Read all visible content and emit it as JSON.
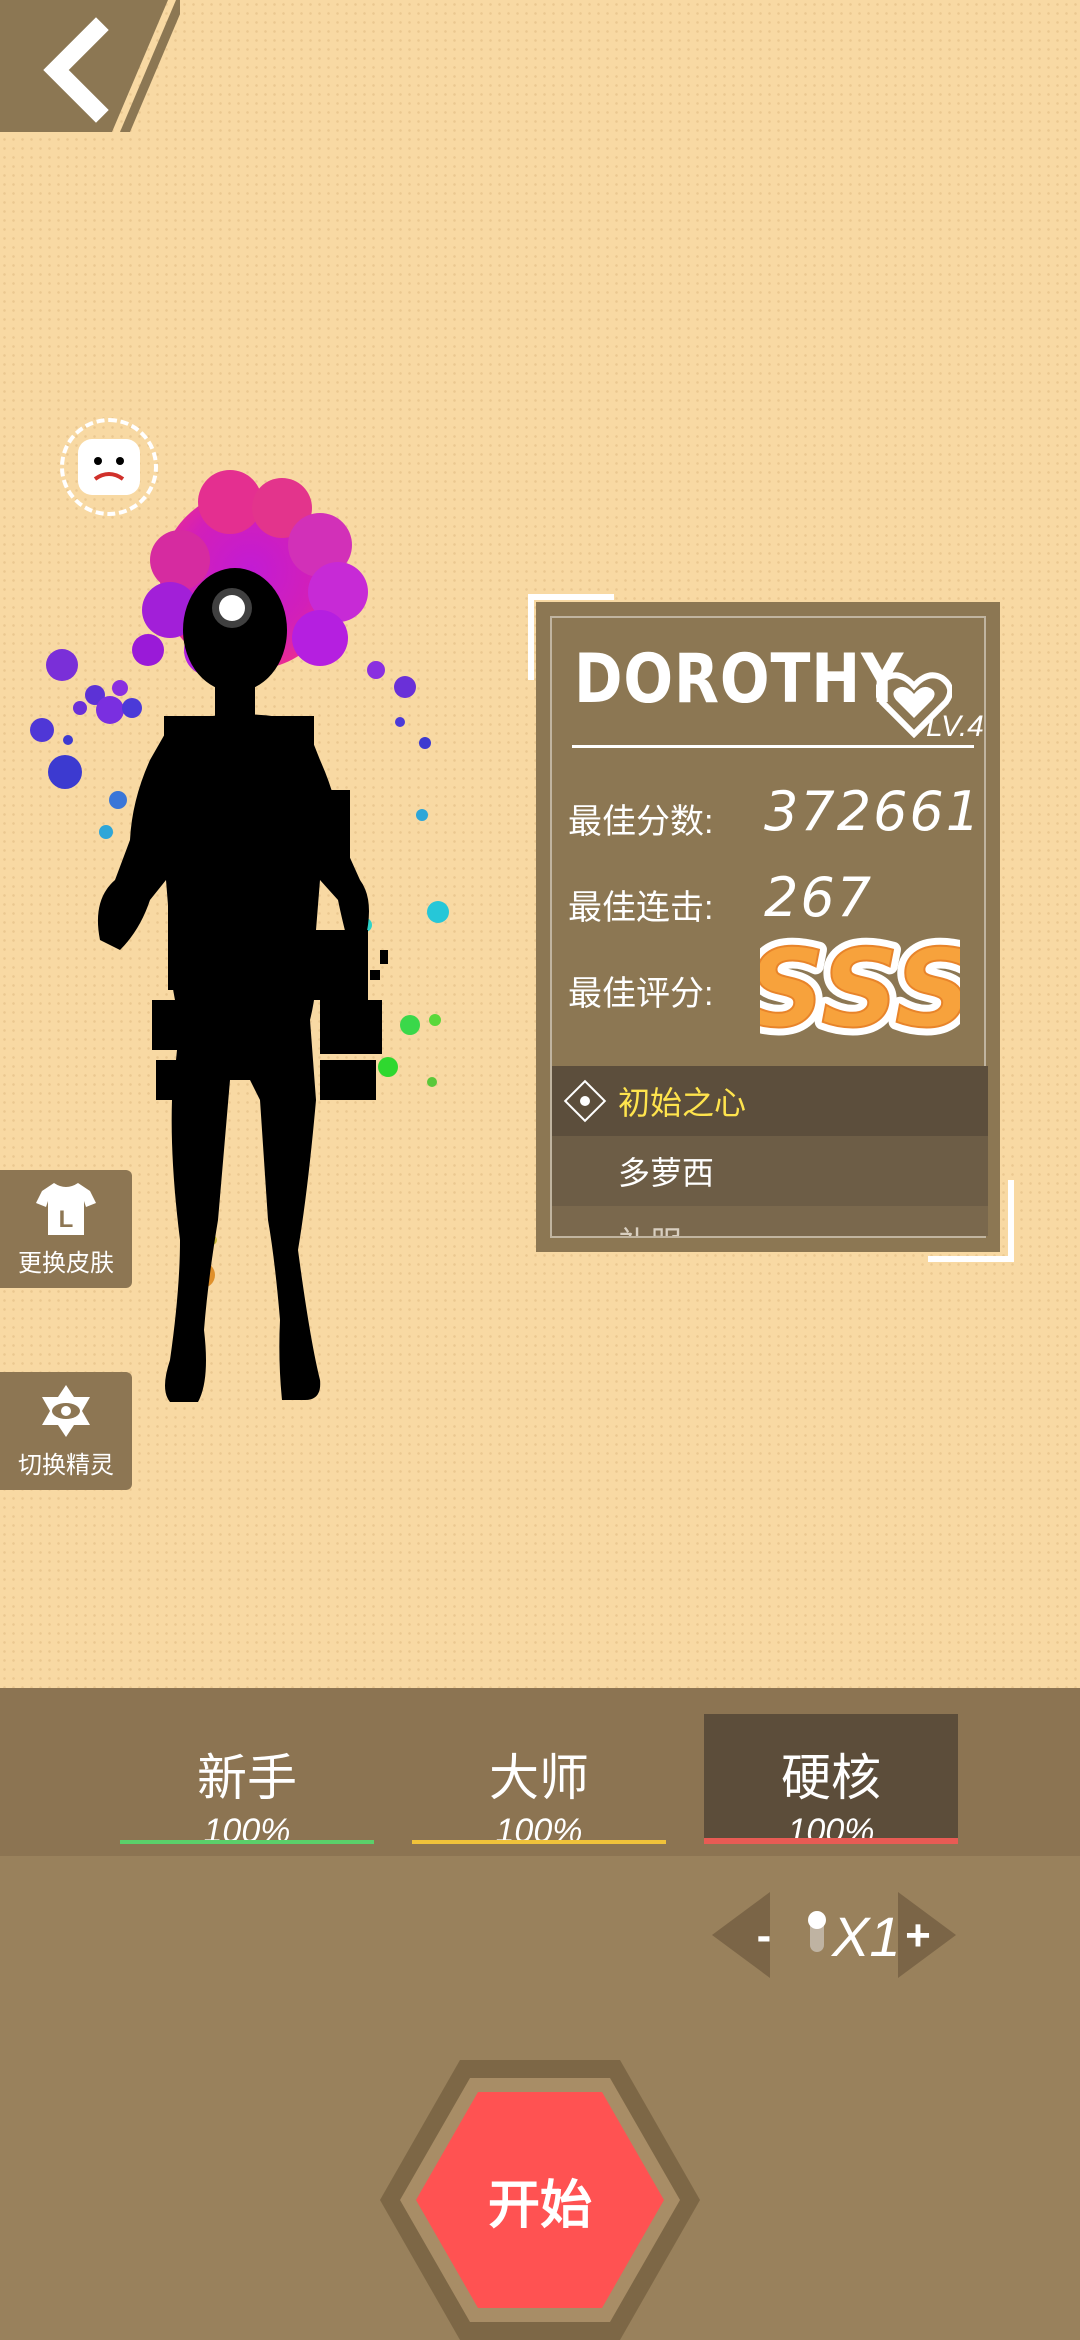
{
  "header": {
    "back_icon": "chevron-left-icon"
  },
  "emoji_badge": {
    "icon": "sad-face-icon"
  },
  "character": {
    "name": "DOROTHY",
    "level": "LV.4"
  },
  "stats": {
    "best_score_label": "最佳分数:",
    "best_score_value": "372661",
    "best_combo_label": "最佳连击:",
    "best_combo_value": "267",
    "best_rating_label": "最佳评分:",
    "best_rating_value": "SSS"
  },
  "skins": [
    {
      "label": "初始之心",
      "selected": true
    },
    {
      "label": "多萝西",
      "selected": false
    },
    {
      "label": "礼服",
      "selected": false
    }
  ],
  "side_buttons": {
    "change_skin": {
      "label": "更换皮肤",
      "icon": "shirt-icon"
    },
    "switch_elf": {
      "label": "切换精灵",
      "icon": "eye-icon"
    }
  },
  "difficulties": [
    {
      "label": "新手",
      "percent": "100%",
      "color": "#5bd06a"
    },
    {
      "label": "大师",
      "percent": "100%",
      "color": "#f0c23a"
    },
    {
      "label": "硬核",
      "percent": "100%",
      "color": "#e85b54"
    }
  ],
  "selected_difficulty": "硬核",
  "multiplier": {
    "minus": "-",
    "value": "X1",
    "plus": "+"
  },
  "start_button": {
    "label": "开始",
    "color": "#ff5252"
  }
}
